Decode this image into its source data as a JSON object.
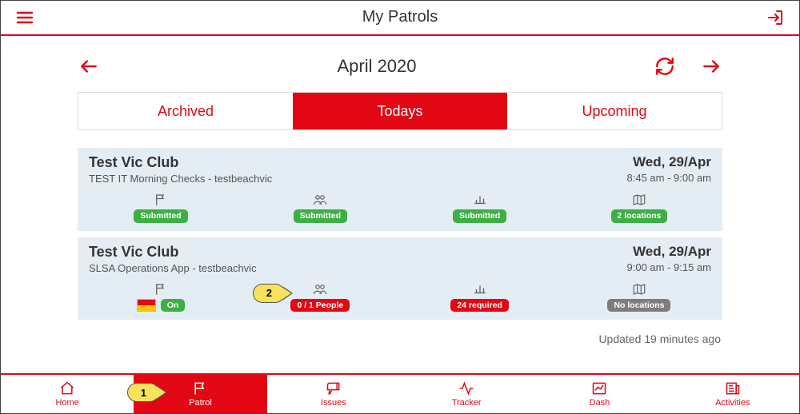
{
  "header": {
    "title": "My Patrols"
  },
  "month": {
    "label": "April 2020"
  },
  "tabs": {
    "archived": "Archived",
    "todays": "Todays",
    "upcoming": "Upcoming"
  },
  "cards": [
    {
      "club": "Test Vic Club",
      "sub": "TEST IT Morning Checks - testbeachvic",
      "date": "Wed, 29/Apr",
      "time": "8:45 am - 9:00 am",
      "m0": {
        "label": "Submitted",
        "cls": "badge-green"
      },
      "m1": {
        "label": "Submitted",
        "cls": "badge-green"
      },
      "m2": {
        "label": "Submitted",
        "cls": "badge-green"
      },
      "m3": {
        "label": "2 locations",
        "cls": "badge-green"
      }
    },
    {
      "club": "Test Vic Club",
      "sub": "SLSA Operations App - testbeachvic",
      "date": "Wed, 29/Apr",
      "time": "9:00 am - 9:15 am",
      "m0": {
        "label": "On",
        "cls": "badge-green"
      },
      "m1": {
        "label": "0 / 1 People",
        "cls": "badge-red"
      },
      "m2": {
        "label": "24 required",
        "cls": "badge-red"
      },
      "m3": {
        "label": "No locations",
        "cls": "badge-grey"
      }
    }
  ],
  "updated": "Updated 19 minutes ago",
  "bottom": {
    "home": "Home",
    "patrol": "Patrol",
    "issues": "Issues",
    "tracker": "Tracker",
    "dash": "Dash",
    "activities": "Activities"
  },
  "callouts": {
    "one": "1",
    "two": "2"
  },
  "colors": {
    "accent": "#e30613",
    "ok": "#3cb043",
    "neutral": "#7d7d7d"
  }
}
